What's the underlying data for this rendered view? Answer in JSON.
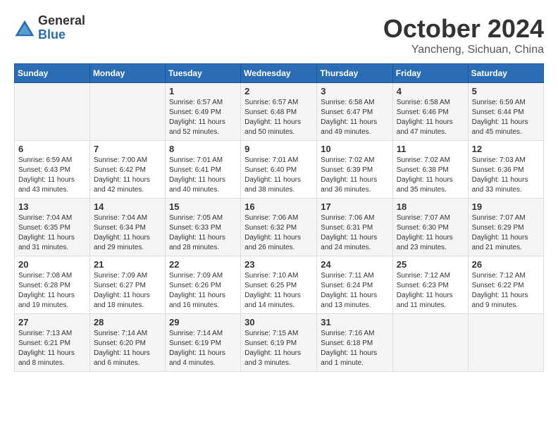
{
  "logo": {
    "general": "General",
    "blue": "Blue"
  },
  "title": {
    "month": "October 2024",
    "location": "Yancheng, Sichuan, China"
  },
  "headers": [
    "Sunday",
    "Monday",
    "Tuesday",
    "Wednesday",
    "Thursday",
    "Friday",
    "Saturday"
  ],
  "weeks": [
    [
      {
        "num": "",
        "sunrise": "",
        "sunset": "",
        "daylight": ""
      },
      {
        "num": "",
        "sunrise": "",
        "sunset": "",
        "daylight": ""
      },
      {
        "num": "1",
        "sunrise": "Sunrise: 6:57 AM",
        "sunset": "Sunset: 6:49 PM",
        "daylight": "Daylight: 11 hours and 52 minutes."
      },
      {
        "num": "2",
        "sunrise": "Sunrise: 6:57 AM",
        "sunset": "Sunset: 6:48 PM",
        "daylight": "Daylight: 11 hours and 50 minutes."
      },
      {
        "num": "3",
        "sunrise": "Sunrise: 6:58 AM",
        "sunset": "Sunset: 6:47 PM",
        "daylight": "Daylight: 11 hours and 49 minutes."
      },
      {
        "num": "4",
        "sunrise": "Sunrise: 6:58 AM",
        "sunset": "Sunset: 6:46 PM",
        "daylight": "Daylight: 11 hours and 47 minutes."
      },
      {
        "num": "5",
        "sunrise": "Sunrise: 6:59 AM",
        "sunset": "Sunset: 6:44 PM",
        "daylight": "Daylight: 11 hours and 45 minutes."
      }
    ],
    [
      {
        "num": "6",
        "sunrise": "Sunrise: 6:59 AM",
        "sunset": "Sunset: 6:43 PM",
        "daylight": "Daylight: 11 hours and 43 minutes."
      },
      {
        "num": "7",
        "sunrise": "Sunrise: 7:00 AM",
        "sunset": "Sunset: 6:42 PM",
        "daylight": "Daylight: 11 hours and 42 minutes."
      },
      {
        "num": "8",
        "sunrise": "Sunrise: 7:01 AM",
        "sunset": "Sunset: 6:41 PM",
        "daylight": "Daylight: 11 hours and 40 minutes."
      },
      {
        "num": "9",
        "sunrise": "Sunrise: 7:01 AM",
        "sunset": "Sunset: 6:40 PM",
        "daylight": "Daylight: 11 hours and 38 minutes."
      },
      {
        "num": "10",
        "sunrise": "Sunrise: 7:02 AM",
        "sunset": "Sunset: 6:39 PM",
        "daylight": "Daylight: 11 hours and 36 minutes."
      },
      {
        "num": "11",
        "sunrise": "Sunrise: 7:02 AM",
        "sunset": "Sunset: 6:38 PM",
        "daylight": "Daylight: 11 hours and 35 minutes."
      },
      {
        "num": "12",
        "sunrise": "Sunrise: 7:03 AM",
        "sunset": "Sunset: 6:36 PM",
        "daylight": "Daylight: 11 hours and 33 minutes."
      }
    ],
    [
      {
        "num": "13",
        "sunrise": "Sunrise: 7:04 AM",
        "sunset": "Sunset: 6:35 PM",
        "daylight": "Daylight: 11 hours and 31 minutes."
      },
      {
        "num": "14",
        "sunrise": "Sunrise: 7:04 AM",
        "sunset": "Sunset: 6:34 PM",
        "daylight": "Daylight: 11 hours and 29 minutes."
      },
      {
        "num": "15",
        "sunrise": "Sunrise: 7:05 AM",
        "sunset": "Sunset: 6:33 PM",
        "daylight": "Daylight: 11 hours and 28 minutes."
      },
      {
        "num": "16",
        "sunrise": "Sunrise: 7:06 AM",
        "sunset": "Sunset: 6:32 PM",
        "daylight": "Daylight: 11 hours and 26 minutes."
      },
      {
        "num": "17",
        "sunrise": "Sunrise: 7:06 AM",
        "sunset": "Sunset: 6:31 PM",
        "daylight": "Daylight: 11 hours and 24 minutes."
      },
      {
        "num": "18",
        "sunrise": "Sunrise: 7:07 AM",
        "sunset": "Sunset: 6:30 PM",
        "daylight": "Daylight: 11 hours and 23 minutes."
      },
      {
        "num": "19",
        "sunrise": "Sunrise: 7:07 AM",
        "sunset": "Sunset: 6:29 PM",
        "daylight": "Daylight: 11 hours and 21 minutes."
      }
    ],
    [
      {
        "num": "20",
        "sunrise": "Sunrise: 7:08 AM",
        "sunset": "Sunset: 6:28 PM",
        "daylight": "Daylight: 11 hours and 19 minutes."
      },
      {
        "num": "21",
        "sunrise": "Sunrise: 7:09 AM",
        "sunset": "Sunset: 6:27 PM",
        "daylight": "Daylight: 11 hours and 18 minutes."
      },
      {
        "num": "22",
        "sunrise": "Sunrise: 7:09 AM",
        "sunset": "Sunset: 6:26 PM",
        "daylight": "Daylight: 11 hours and 16 minutes."
      },
      {
        "num": "23",
        "sunrise": "Sunrise: 7:10 AM",
        "sunset": "Sunset: 6:25 PM",
        "daylight": "Daylight: 11 hours and 14 minutes."
      },
      {
        "num": "24",
        "sunrise": "Sunrise: 7:11 AM",
        "sunset": "Sunset: 6:24 PM",
        "daylight": "Daylight: 11 hours and 13 minutes."
      },
      {
        "num": "25",
        "sunrise": "Sunrise: 7:12 AM",
        "sunset": "Sunset: 6:23 PM",
        "daylight": "Daylight: 11 hours and 11 minutes."
      },
      {
        "num": "26",
        "sunrise": "Sunrise: 7:12 AM",
        "sunset": "Sunset: 6:22 PM",
        "daylight": "Daylight: 11 hours and 9 minutes."
      }
    ],
    [
      {
        "num": "27",
        "sunrise": "Sunrise: 7:13 AM",
        "sunset": "Sunset: 6:21 PM",
        "daylight": "Daylight: 11 hours and 8 minutes."
      },
      {
        "num": "28",
        "sunrise": "Sunrise: 7:14 AM",
        "sunset": "Sunset: 6:20 PM",
        "daylight": "Daylight: 11 hours and 6 minutes."
      },
      {
        "num": "29",
        "sunrise": "Sunrise: 7:14 AM",
        "sunset": "Sunset: 6:19 PM",
        "daylight": "Daylight: 11 hours and 4 minutes."
      },
      {
        "num": "30",
        "sunrise": "Sunrise: 7:15 AM",
        "sunset": "Sunset: 6:19 PM",
        "daylight": "Daylight: 11 hours and 3 minutes."
      },
      {
        "num": "31",
        "sunrise": "Sunrise: 7:16 AM",
        "sunset": "Sunset: 6:18 PM",
        "daylight": "Daylight: 11 hours and 1 minute."
      },
      {
        "num": "",
        "sunrise": "",
        "sunset": "",
        "daylight": ""
      },
      {
        "num": "",
        "sunrise": "",
        "sunset": "",
        "daylight": ""
      }
    ]
  ]
}
